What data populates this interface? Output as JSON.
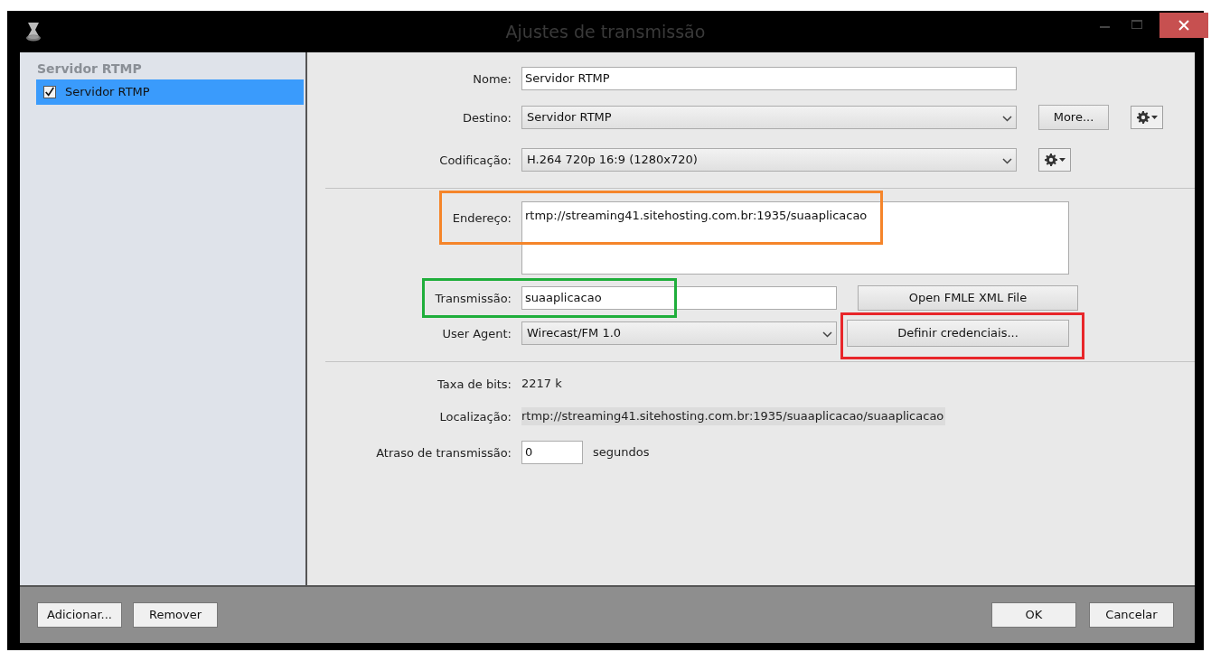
{
  "window": {
    "title": "Ajustes de transmissão"
  },
  "sidebar": {
    "heading": "Servidor RTMP",
    "items": [
      {
        "label": "Servidor RTMP",
        "checked": true,
        "selected": true
      }
    ]
  },
  "form": {
    "name": {
      "label": "Nome:",
      "value": "Servidor RTMP"
    },
    "destination": {
      "label": "Destino:",
      "value": "Servidor RTMP",
      "button": "More..."
    },
    "encoding": {
      "label": "Codificação:",
      "value": "H.264 720p 16:9 (1280x720)"
    },
    "address": {
      "label": "Endereço:",
      "value": "rtmp://streaming41.sitehosting.com.br:1935/suaaplicacao"
    },
    "stream": {
      "label": "Transmissão:",
      "value": "suaaplicacao",
      "button": "Open FMLE XML File"
    },
    "user_agent": {
      "label": "User Agent:",
      "value": "Wirecast/FM 1.0",
      "button": "Definir credenciais..."
    },
    "bitrate": {
      "label": "Taxa de bits:",
      "value": "2217 k"
    },
    "location": {
      "label": "Localização:",
      "value": "rtmp://streaming41.sitehosting.com.br:1935/suaaplicacao/suaaplicacao"
    },
    "delay": {
      "label": "Atraso de transmissão:",
      "value": "0",
      "unit": "segundos"
    }
  },
  "highlights": [
    {
      "color": "#f5852a"
    },
    {
      "color": "#1fae3b"
    },
    {
      "color": "#e8262a"
    }
  ],
  "footer": {
    "left_buttons": [
      "Adicionar...",
      "Remover"
    ],
    "right_buttons": [
      "OK",
      "Cancelar"
    ]
  }
}
